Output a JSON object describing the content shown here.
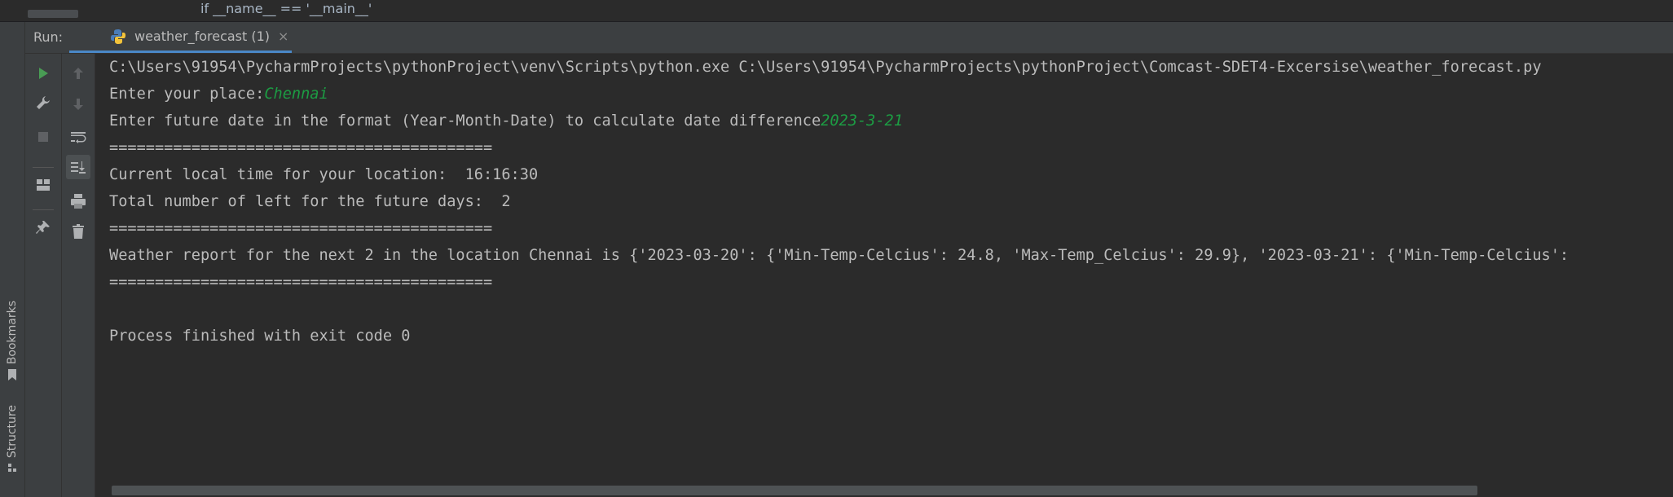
{
  "editor": {
    "code_line": "if __name__ == '__main__'"
  },
  "side_tabs": {
    "bookmarks": "Bookmarks",
    "structure": "Structure"
  },
  "run_panel": {
    "label": "Run:",
    "tab_label": "weather_forecast (1)",
    "tab_close": "×"
  },
  "console": {
    "lines": {
      "command": "C:\\Users\\91954\\PycharmProjects\\pythonProject\\venv\\Scripts\\python.exe C:\\Users\\91954\\PycharmProjects\\pythonProject\\Comcast-SDET4-Excersise\\weather_forecast.py",
      "place_prompt": "Enter your place:",
      "place_input": "Chennai",
      "date_prompt": "Enter future date in the format (Year-Month-Date) to calculate date difference",
      "date_input": "2023-3-21",
      "sep1": "==========================================",
      "local_time": "Current local time for your location:  16:16:30",
      "days_left": "Total number of left for the future days:  2",
      "sep2": "==========================================",
      "report": "Weather report for the next 2 in the location Chennai is {'2023-03-20': {'Min-Temp-Celcius': 24.8, 'Max-Temp_Celcius': 29.9}, '2023-03-21': {'Min-Temp-Celcius':",
      "sep3": "==========================================",
      "blank": "",
      "finished": "Process finished with exit code 0"
    }
  },
  "icons": {
    "rerun": "play-icon",
    "settings": "wrench-icon",
    "stop": "stop-icon",
    "layout": "layout-icon",
    "pin": "pin-icon",
    "up": "arrow-up-icon",
    "down": "arrow-down-icon",
    "soft_wrap": "soft-wrap-icon",
    "scroll_to_end": "scroll-to-end-icon",
    "print": "print-icon",
    "clear": "trash-icon"
  },
  "colors": {
    "background": "#2b2b2b",
    "panel": "#3c3f41",
    "text": "#bbbbbb",
    "user_input": "#1c9c43",
    "run_green": "#499c54",
    "tab_underline": "#4a88c7"
  }
}
